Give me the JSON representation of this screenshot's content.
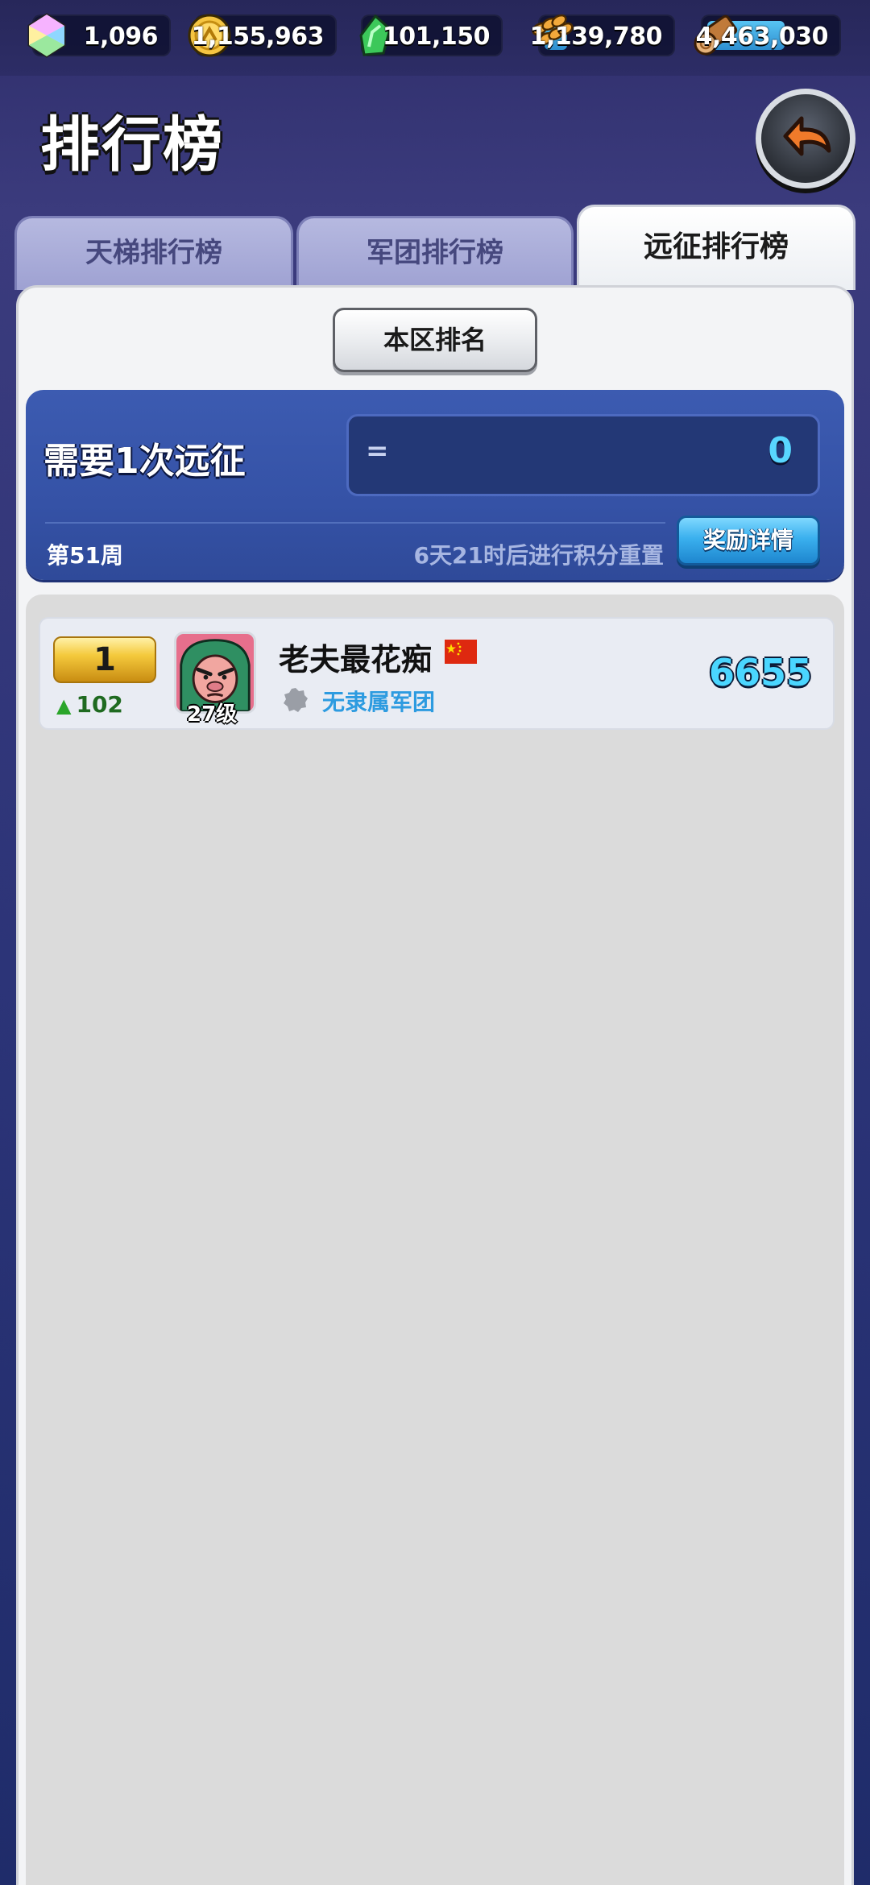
{
  "resources": [
    {
      "name": "gem",
      "icon": "gem-icon",
      "value": "1,096",
      "color": "#9ad3ff"
    },
    {
      "name": "gold",
      "icon": "gold-coin-icon",
      "value": "1,155,963",
      "color": "#f5c542"
    },
    {
      "name": "jade",
      "icon": "green-shard-icon",
      "value": "101,150",
      "color": "#3cc85a"
    },
    {
      "name": "food",
      "icon": "wheat-icon",
      "value": "1,139,780",
      "color": "#f2a93b"
    },
    {
      "name": "wood",
      "icon": "log-icon",
      "value": "4,463,030",
      "color": "#c07a3a"
    }
  ],
  "header": {
    "title": "排行榜",
    "back_icon": "back-arrow-icon"
  },
  "tabs": [
    {
      "label": "天梯排行榜",
      "active": false
    },
    {
      "label": "军团排行榜",
      "active": false
    },
    {
      "label": "远征排行榜",
      "active": true
    }
  ],
  "panel": {
    "region_button": "本区排名",
    "requirement_label": "需要1次远征",
    "requirement_symbol": "=",
    "requirement_value": "0",
    "week": "第51周",
    "reset_text": "6天21时后进行积分重置",
    "reward_button": "奖励详情"
  },
  "ranking": [
    {
      "rank": "1",
      "change": "102",
      "change_direction": "up",
      "avatar_icon": "green-ogre-avatar-icon",
      "level": "27级",
      "name": "老夫最花痴",
      "flag_icon": "china-flag-icon",
      "guild_icon": "guild-emblem-icon",
      "guild": "无隶属军团",
      "score": "6655"
    }
  ],
  "colors": {
    "accent_blue": "#3552a6",
    "score_cyan": "#4ad6ff",
    "gold": "#f4c93c"
  }
}
